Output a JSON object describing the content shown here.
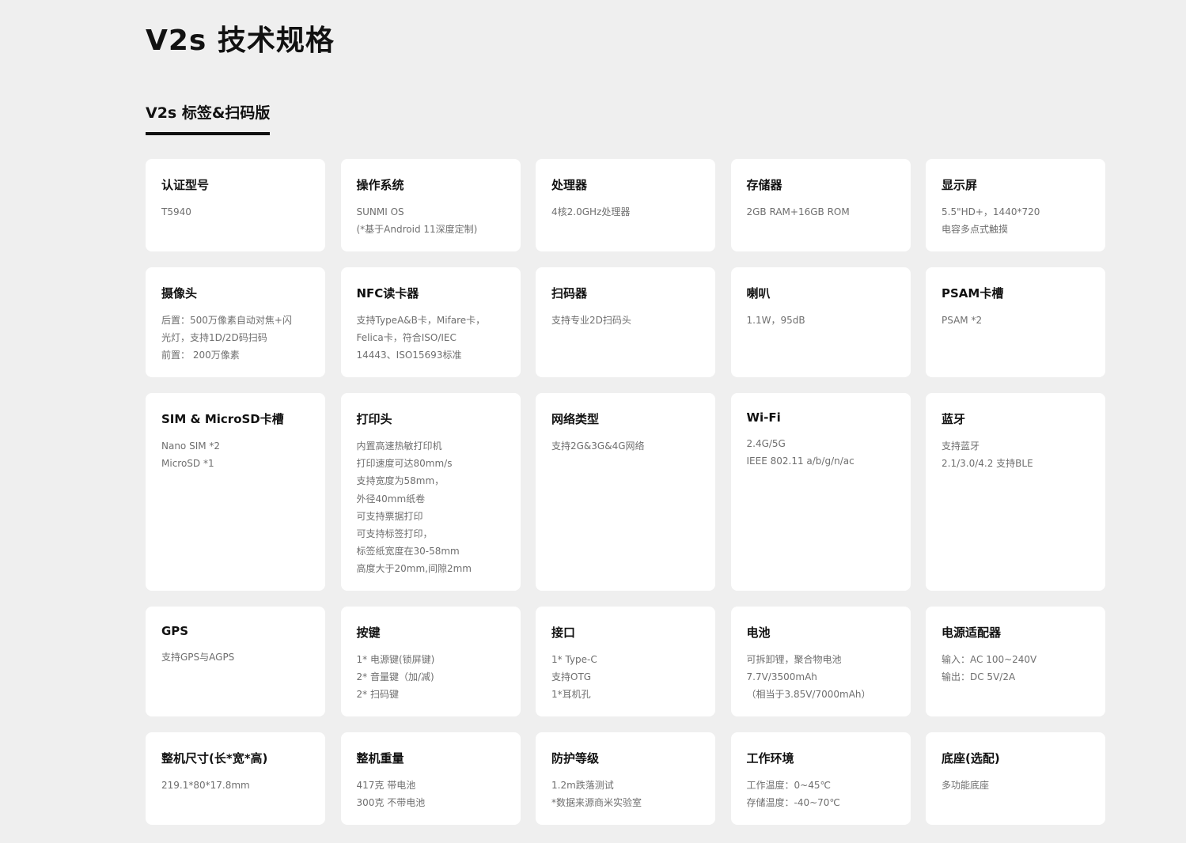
{
  "page": {
    "title": "V2s 技术规格"
  },
  "tabs": [
    {
      "label": "V2s 标签&扫码版",
      "active": true
    }
  ],
  "specs": [
    {
      "name": "certification",
      "title": "认证型号",
      "lines": [
        "T5940"
      ]
    },
    {
      "name": "os",
      "title": "操作系统",
      "lines": [
        "SUNMI OS",
        "(*基于Android 11深度定制)"
      ]
    },
    {
      "name": "processor",
      "title": "处理器",
      "lines": [
        "4核2.0GHz处理器"
      ]
    },
    {
      "name": "storage",
      "title": "存储器",
      "lines": [
        "2GB RAM+16GB ROM"
      ]
    },
    {
      "name": "display",
      "title": "显示屏",
      "lines": [
        "5.5\"HD+，1440*720",
        "电容多点式触摸"
      ]
    },
    {
      "name": "camera",
      "title": "摄像头",
      "lines": [
        "后置：500万像素自动对焦+闪",
        "光灯，支持1D/2D码扫码",
        "前置： 200万像素"
      ]
    },
    {
      "name": "nfc",
      "title": "NFC读卡器",
      "lines": [
        "支持TypeA&B卡，Mifare卡，",
        "Felica卡，符合ISO/IEC",
        "14443、ISO15693标准"
      ]
    },
    {
      "name": "scanner",
      "title": "扫码器",
      "lines": [
        "支持专业2D扫码头"
      ]
    },
    {
      "name": "speaker",
      "title": "喇叭",
      "lines": [
        "1.1W，95dB"
      ]
    },
    {
      "name": "psam",
      "title": "PSAM卡槽",
      "lines": [
        "PSAM *2"
      ]
    },
    {
      "name": "sim-microsd",
      "title": "SIM & MicroSD卡槽",
      "lines": [
        "Nano SIM *2",
        "MicroSD *1"
      ]
    },
    {
      "name": "printer",
      "title": "打印头",
      "lines": [
        "内置高速热敏打印机",
        "打印速度可达80mm/s",
        "支持宽度为58mm，",
        "外径40mm纸卷",
        "可支持票据打印",
        "可支持标签打印，",
        "标签纸宽度在30-58mm",
        "高度大于20mm,间隙2mm"
      ]
    },
    {
      "name": "network",
      "title": "网络类型",
      "lines": [
        "支持2G&3G&4G网络"
      ]
    },
    {
      "name": "wifi",
      "title": "Wi-Fi",
      "lines": [
        "2.4G/5G",
        "IEEE 802.11 a/b/g/n/ac"
      ]
    },
    {
      "name": "bluetooth",
      "title": "蓝牙",
      "lines": [
        "支持蓝牙",
        "2.1/3.0/4.2 支持BLE"
      ]
    },
    {
      "name": "gps",
      "title": "GPS",
      "lines": [
        "支持GPS与AGPS"
      ]
    },
    {
      "name": "buttons",
      "title": "按键",
      "lines": [
        "1* 电源键(锁屏键)",
        "2* 音量键（加/减)",
        "2* 扫码键"
      ]
    },
    {
      "name": "ports",
      "title": "接口",
      "lines": [
        "1* Type-C",
        "支持OTG",
        "1*耳机孔"
      ]
    },
    {
      "name": "battery",
      "title": "电池",
      "lines": [
        "可拆卸锂，聚合物电池",
        "7.7V/3500mAh",
        "（相当于3.85V/7000mAh）"
      ]
    },
    {
      "name": "power-adapter",
      "title": "电源适配器",
      "lines": [
        "输入：AC 100~240V",
        "输出：DC 5V/2A"
      ]
    },
    {
      "name": "dimensions",
      "title": "整机尺寸(长*宽*高)",
      "lines": [
        "219.1*80*17.8mm"
      ]
    },
    {
      "name": "weight",
      "title": "整机重量",
      "lines": [
        "417克 带电池",
        "300克 不带电池"
      ]
    },
    {
      "name": "protection",
      "title": "防护等级",
      "lines": [
        "1.2m跌落测试",
        "*数据来源商米实验室"
      ]
    },
    {
      "name": "environment",
      "title": "工作环境",
      "lines": [
        "工作温度：0~45℃",
        "存储温度：-40~70℃"
      ]
    },
    {
      "name": "base",
      "title": "底座(选配)",
      "lines": [
        "多功能底座"
      ]
    }
  ]
}
